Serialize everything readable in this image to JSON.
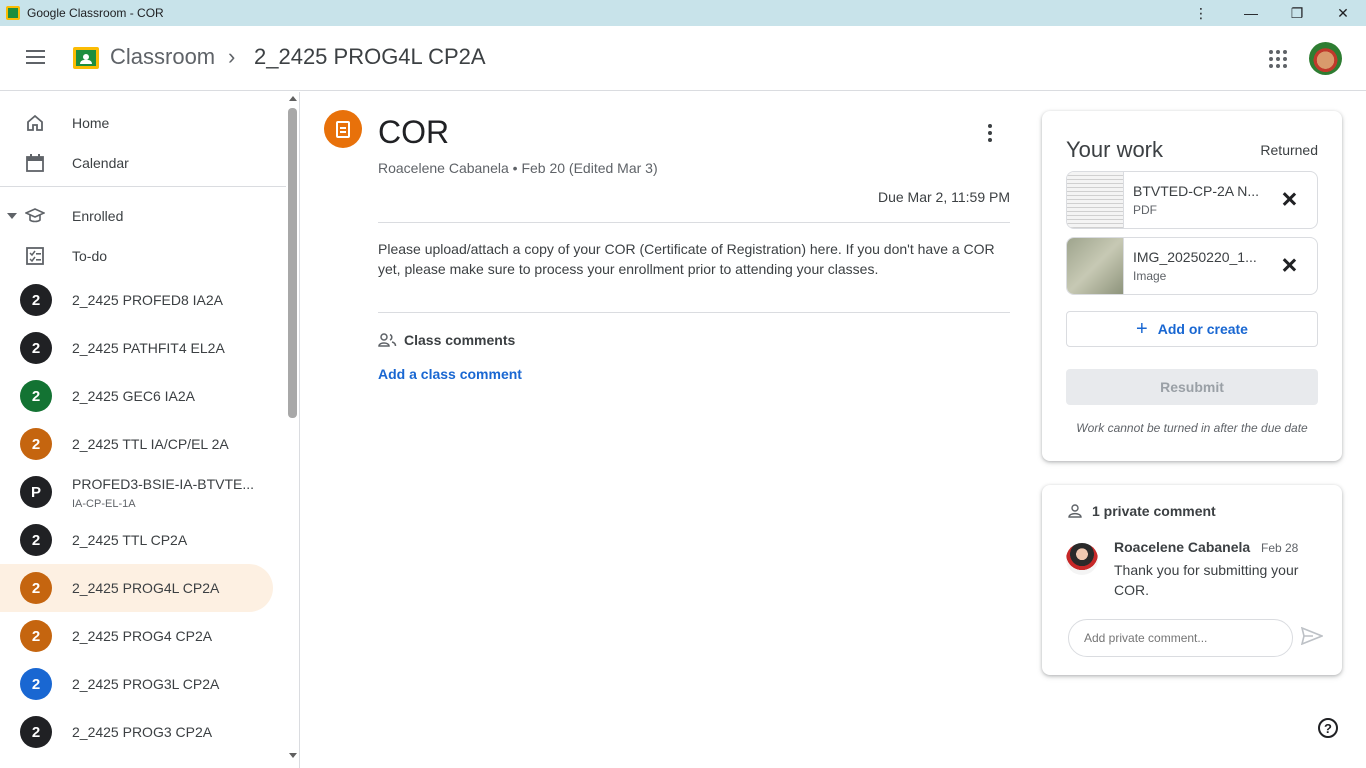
{
  "window": {
    "title": "Google Classroom - COR",
    "controls": [
      "⋮",
      "—",
      "❐",
      "✕"
    ]
  },
  "header": {
    "brand": "Classroom",
    "separator": "›",
    "class_name": "2_2425 PROG4L CP2A"
  },
  "sidebar": {
    "home": "Home",
    "calendar": "Calendar",
    "enrolled": "Enrolled",
    "todo": "To-do",
    "classes": [
      {
        "initial": "2",
        "label": "2_2425 PROFED8 IA2A",
        "color": "#202124"
      },
      {
        "initial": "2",
        "label": "2_2425 PATHFIT4 EL2A",
        "color": "#202124"
      },
      {
        "initial": "2",
        "label": "2_2425 GEC6 IA2A",
        "color": "#137333"
      },
      {
        "initial": "2",
        "label": "2_2425 TTL IA/CP/EL 2A",
        "color": "#c5650f"
      },
      {
        "initial": "P",
        "label": "PROFED3-BSIE-IA-BTVTE...",
        "sub": "IA-CP-EL-1A",
        "color": "#202124"
      },
      {
        "initial": "2",
        "label": "2_2425 TTL CP2A",
        "color": "#202124"
      },
      {
        "initial": "2",
        "label": "2_2425 PROG4L CP2A",
        "color": "#c5650f",
        "active": true
      },
      {
        "initial": "2",
        "label": "2_2425 PROG4 CP2A",
        "color": "#c5650f"
      },
      {
        "initial": "2",
        "label": "2_2425 PROG3L CP2A",
        "color": "#1967d2"
      },
      {
        "initial": "2",
        "label": "2_2425 PROG3 CP2A",
        "color": "#202124"
      }
    ]
  },
  "assignment": {
    "title": "COR",
    "meta": "Roacelene Cabanela • Feb 20 (Edited Mar 3)",
    "due": "Due Mar 2, 11:59 PM",
    "description": "Please upload/attach a copy of your COR (Certificate of Registration) here. If you don't have a COR yet, please make sure to process your enrollment prior to attending your classes.",
    "class_comments_label": "Class comments",
    "add_class_comment": "Add a class comment"
  },
  "your_work": {
    "title": "Your work",
    "status": "Returned",
    "attachments": [
      {
        "name": "BTVTED-CP-2A N...",
        "type": "PDF"
      },
      {
        "name": "IMG_20250220_1...",
        "type": "Image"
      }
    ],
    "add_label": "Add or create",
    "resubmit_label": "Resubmit",
    "note": "Work cannot be turned in after the due date"
  },
  "private_comments": {
    "header": "1 private comment",
    "comments": [
      {
        "author": "Roacelene Cabanela",
        "date": "Feb 28",
        "text": "Thank you for submitting your COR."
      }
    ],
    "placeholder": "Add private comment..."
  },
  "help": "?"
}
